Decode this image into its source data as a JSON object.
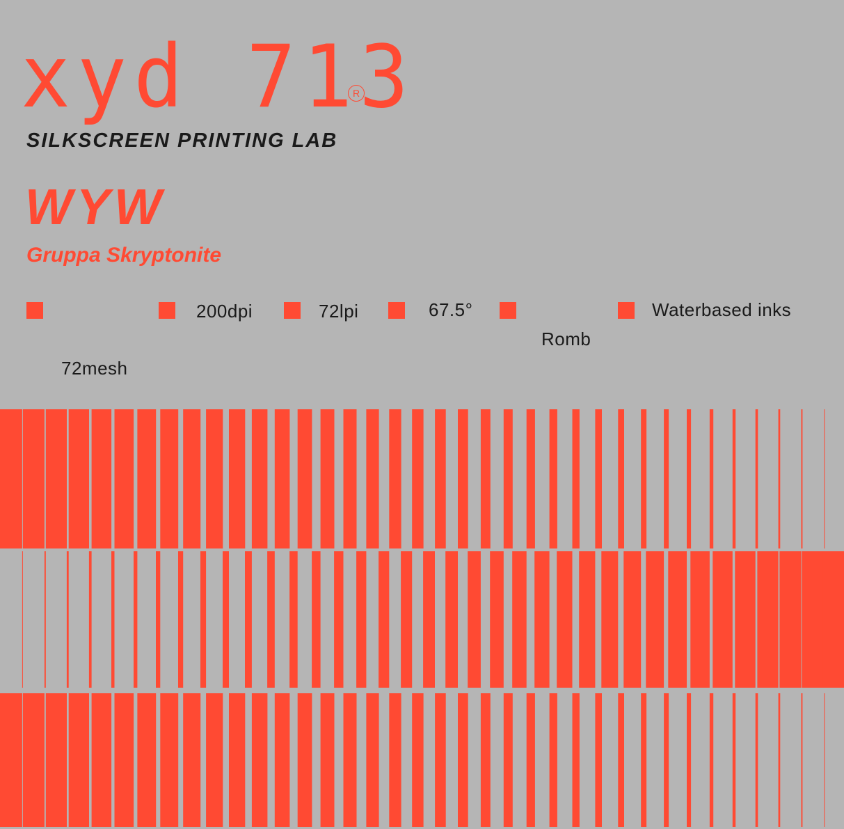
{
  "logo": {
    "text": "xyd 713",
    "registered": "R"
  },
  "lab_name": "SILKSCREEN PRINTING LAB",
  "title": "WYW",
  "artist": "Gruppa Skryptonite",
  "specs": {
    "mesh": "72mesh",
    "resolution": "200dpi",
    "lines": "72lpi",
    "angle": "67.5°",
    "dot": "Romb",
    "ink": "Waterbased inks"
  },
  "accent_color": "#ff4a33",
  "background_color": "#b5b5b5"
}
